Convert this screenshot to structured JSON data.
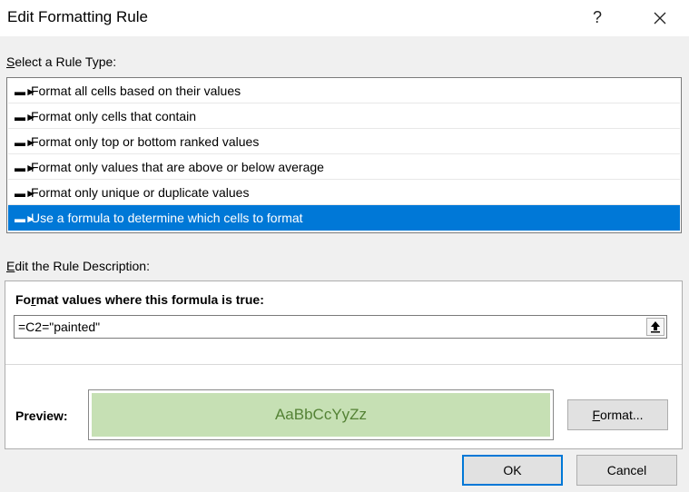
{
  "window": {
    "title": "Edit Formatting Rule",
    "help_label": "?",
    "close_label": "✕"
  },
  "rule_type": {
    "label_first": "S",
    "label_rest": "elect a Rule Type:",
    "items": [
      {
        "label": "Format all cells based on their values",
        "selected": false
      },
      {
        "label": "Format only cells that contain",
        "selected": false
      },
      {
        "label": "Format only top or bottom ranked values",
        "selected": false
      },
      {
        "label": "Format only values that are above or below average",
        "selected": false
      },
      {
        "label": "Format only unique or duplicate values",
        "selected": false
      },
      {
        "label": "Use a formula to determine which cells to format",
        "selected": true
      }
    ],
    "bullet_icon": "arrow-right-icon"
  },
  "description": {
    "label_first": "E",
    "label_rest": "dit the Rule Description:",
    "heading_first": "Fo",
    "heading_u": "r",
    "heading_rest": "mat values where this formula is true:",
    "formula_value": "=C2=\"painted\"",
    "collapse_icon": "collapse-dialog-icon",
    "preview_label": "Preview:",
    "preview_text": "AaBbCcYyZz",
    "preview_fill": "#c6e0b4",
    "preview_font_color": "#548235",
    "format_first": "F",
    "format_rest": "ormat..."
  },
  "buttons": {
    "ok": "OK",
    "cancel": "Cancel"
  },
  "colors": {
    "selection": "#0078d7"
  }
}
